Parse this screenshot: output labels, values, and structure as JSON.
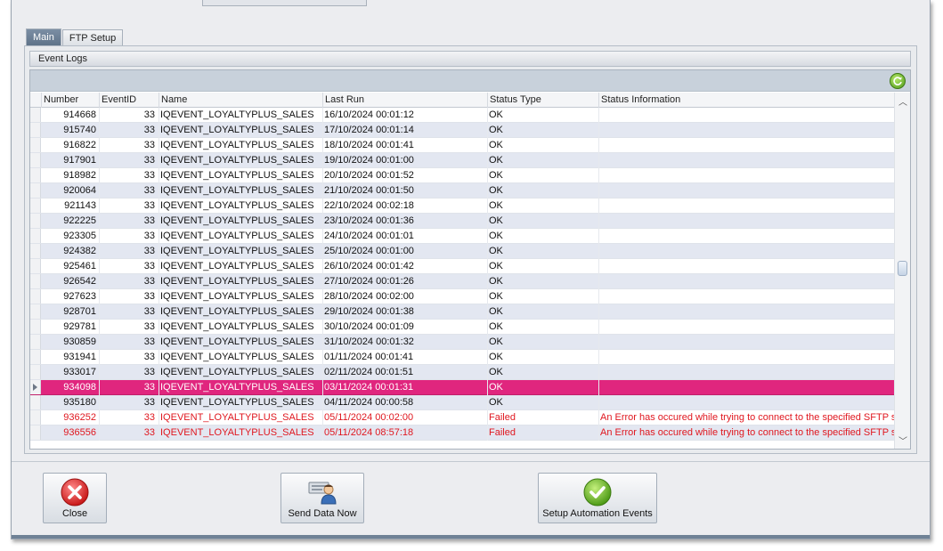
{
  "tabs": [
    {
      "label": "Main",
      "active": true
    },
    {
      "label": "FTP Setup",
      "active": false
    }
  ],
  "group": {
    "title": "Event Logs"
  },
  "grid": {
    "refresh_icon": "refresh-icon",
    "columns": [
      "Number",
      "EventID",
      "Name",
      "Last Run",
      "Status Type",
      "Status Information"
    ],
    "rows": [
      {
        "number": "914668",
        "event_id": "33",
        "name": "IQEVENT_LOYALTYPLUS_SALES",
        "last_run": "16/10/2024 00:01:12",
        "status": "OK",
        "info": ""
      },
      {
        "number": "915740",
        "event_id": "33",
        "name": "IQEVENT_LOYALTYPLUS_SALES",
        "last_run": "17/10/2024 00:01:14",
        "status": "OK",
        "info": ""
      },
      {
        "number": "916822",
        "event_id": "33",
        "name": "IQEVENT_LOYALTYPLUS_SALES",
        "last_run": "18/10/2024 00:01:41",
        "status": "OK",
        "info": ""
      },
      {
        "number": "917901",
        "event_id": "33",
        "name": "IQEVENT_LOYALTYPLUS_SALES",
        "last_run": "19/10/2024 00:01:00",
        "status": "OK",
        "info": ""
      },
      {
        "number": "918982",
        "event_id": "33",
        "name": "IQEVENT_LOYALTYPLUS_SALES",
        "last_run": "20/10/2024 00:01:52",
        "status": "OK",
        "info": ""
      },
      {
        "number": "920064",
        "event_id": "33",
        "name": "IQEVENT_LOYALTYPLUS_SALES",
        "last_run": "21/10/2024 00:01:50",
        "status": "OK",
        "info": ""
      },
      {
        "number": "921143",
        "event_id": "33",
        "name": "IQEVENT_LOYALTYPLUS_SALES",
        "last_run": "22/10/2024 00:02:18",
        "status": "OK",
        "info": ""
      },
      {
        "number": "922225",
        "event_id": "33",
        "name": "IQEVENT_LOYALTYPLUS_SALES",
        "last_run": "23/10/2024 00:01:36",
        "status": "OK",
        "info": ""
      },
      {
        "number": "923305",
        "event_id": "33",
        "name": "IQEVENT_LOYALTYPLUS_SALES",
        "last_run": "24/10/2024 00:01:01",
        "status": "OK",
        "info": ""
      },
      {
        "number": "924382",
        "event_id": "33",
        "name": "IQEVENT_LOYALTYPLUS_SALES",
        "last_run": "25/10/2024 00:01:00",
        "status": "OK",
        "info": ""
      },
      {
        "number": "925461",
        "event_id": "33",
        "name": "IQEVENT_LOYALTYPLUS_SALES",
        "last_run": "26/10/2024 00:01:42",
        "status": "OK",
        "info": ""
      },
      {
        "number": "926542",
        "event_id": "33",
        "name": "IQEVENT_LOYALTYPLUS_SALES",
        "last_run": "27/10/2024 00:01:26",
        "status": "OK",
        "info": ""
      },
      {
        "number": "927623",
        "event_id": "33",
        "name": "IQEVENT_LOYALTYPLUS_SALES",
        "last_run": "28/10/2024 00:02:00",
        "status": "OK",
        "info": ""
      },
      {
        "number": "928701",
        "event_id": "33",
        "name": "IQEVENT_LOYALTYPLUS_SALES",
        "last_run": "29/10/2024 00:01:38",
        "status": "OK",
        "info": ""
      },
      {
        "number": "929781",
        "event_id": "33",
        "name": "IQEVENT_LOYALTYPLUS_SALES",
        "last_run": "30/10/2024 00:01:09",
        "status": "OK",
        "info": ""
      },
      {
        "number": "930859",
        "event_id": "33",
        "name": "IQEVENT_LOYALTYPLUS_SALES",
        "last_run": "31/10/2024 00:01:32",
        "status": "OK",
        "info": ""
      },
      {
        "number": "931941",
        "event_id": "33",
        "name": "IQEVENT_LOYALTYPLUS_SALES",
        "last_run": "01/11/2024 00:01:41",
        "status": "OK",
        "info": ""
      },
      {
        "number": "933017",
        "event_id": "33",
        "name": "IQEVENT_LOYALTYPLUS_SALES",
        "last_run": "02/11/2024 00:01:51",
        "status": "OK",
        "info": ""
      },
      {
        "number": "934098",
        "event_id": "33",
        "name": "IQEVENT_LOYALTYPLUS_SALES",
        "last_run": "03/11/2024 00:01:31",
        "status": "OK",
        "info": "",
        "selected": true
      },
      {
        "number": "935180",
        "event_id": "33",
        "name": "IQEVENT_LOYALTYPLUS_SALES",
        "last_run": "04/11/2024 00:00:58",
        "status": "OK",
        "info": ""
      },
      {
        "number": "936252",
        "event_id": "33",
        "name": "IQEVENT_LOYALTYPLUS_SALES",
        "last_run": "05/11/2024 00:02:00",
        "status": "Failed",
        "info": "An Error has occured while trying to connect to the specified SFTP se"
      },
      {
        "number": "936556",
        "event_id": "33",
        "name": "IQEVENT_LOYALTYPLUS_SALES",
        "last_run": "05/11/2024 08:57:18",
        "status": "Failed",
        "info": "An Error has occured while trying to connect to the specified SFTP se"
      }
    ]
  },
  "buttons": {
    "close": {
      "label": "Close",
      "icon": "close-icon"
    },
    "send": {
      "label": "Send Data Now",
      "icon": "send-data-icon"
    },
    "setup": {
      "label": "Setup Automation Events",
      "icon": "checkmark-icon"
    }
  },
  "colors": {
    "selected_row": "#e0267e",
    "failed_text": "#e0171f",
    "alt_row": "#e3e7f1"
  }
}
